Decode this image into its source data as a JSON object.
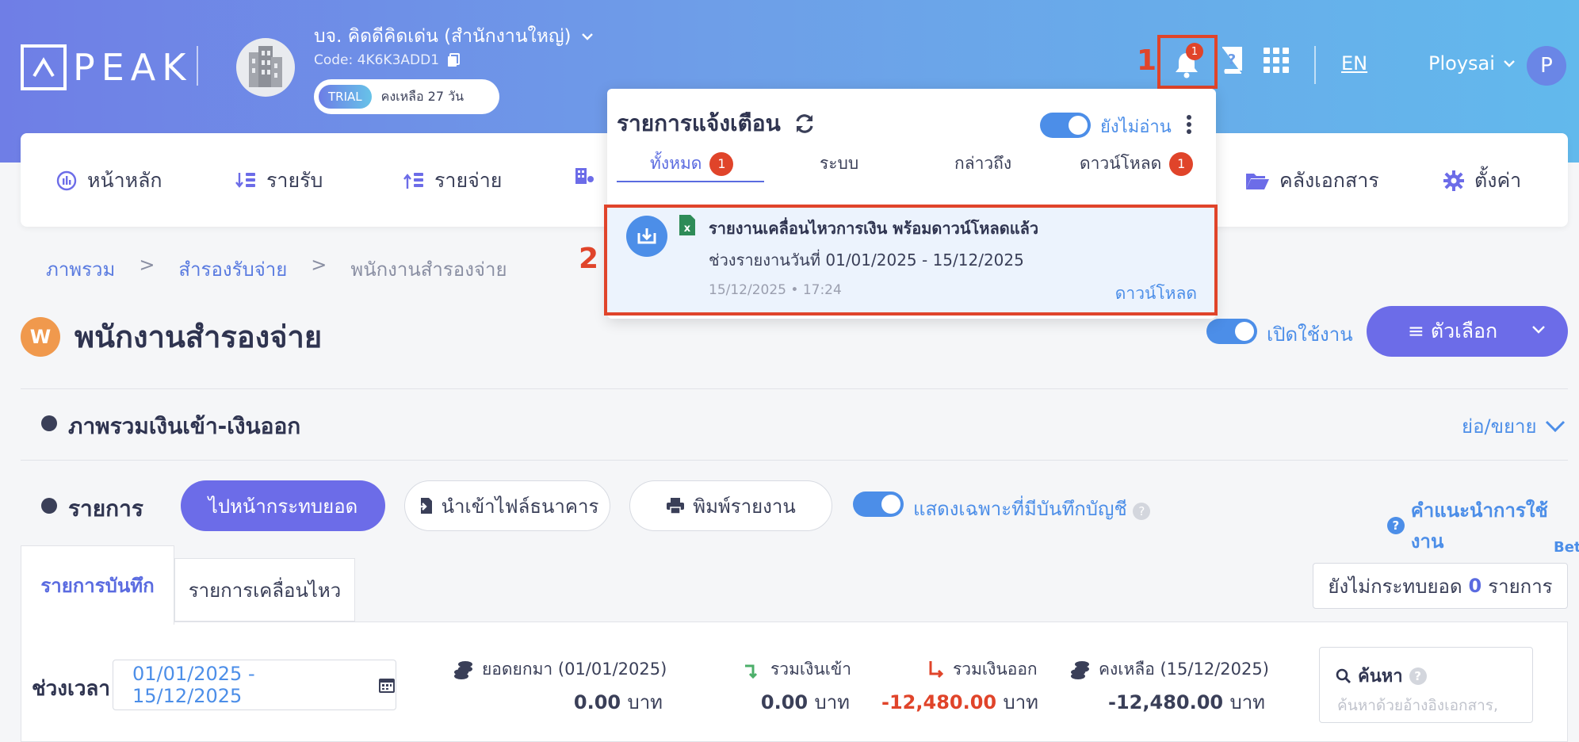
{
  "brand": {
    "logo_text": "PEAK"
  },
  "company": {
    "name": "บจ. คิดดีคิดเด่น (สำนักงานใหญ่)",
    "code": "Code: 4K6K3ADD1",
    "trial_label": "TRIAL",
    "trial_remaining": "คงเหลือ 27 วัน"
  },
  "header": {
    "bell_badge": "1",
    "language": "EN",
    "user_name": "Ploysai",
    "user_initial": "P"
  },
  "markers": {
    "one": "1",
    "two": "2"
  },
  "nav": {
    "items": [
      {
        "label": "หน้าหลัก"
      },
      {
        "label": "รายรับ"
      },
      {
        "label": "รายจ่าย"
      },
      {
        "label": "คลังเอกสาร"
      },
      {
        "label": "ตั้งค่า"
      }
    ]
  },
  "breadcrumb": {
    "items": [
      "ภาพรวม",
      ">",
      "สำรองรับจ่าย",
      ">",
      "พนักงานสำรองจ่าย"
    ]
  },
  "page": {
    "badge": "W",
    "title": "พนักงานสำรองจ่าย",
    "enabled_label": "เปิดใช้งาน",
    "options_label": "≡ ตัวเลือก"
  },
  "overview": {
    "title": "ภาพรวมเงินเข้า-เงินออก",
    "collapse_label": "ย่อ/ขยาย"
  },
  "list": {
    "title": "รายการ",
    "go_reconcile": "ไปหน้ากระทบยอด",
    "import_bank": "นำเข้าไฟล์ธนาคาร",
    "print_report": "พิมพ์รายงาน",
    "show_only_label": "แสดงเฉพาะที่มีบันทึกบัญชี",
    "help_label": "คำแนะนำการใช้งาน",
    "beta": "Bet"
  },
  "tabs": [
    {
      "label": "รายการบันทึก"
    },
    {
      "label": "รายการเคลื่อนไหว"
    }
  ],
  "unreconciled": {
    "prefix": "ยังไม่กระทบยอด",
    "count": "0",
    "suffix": "รายการ"
  },
  "summary": {
    "period_label": "ช่วงเวลา",
    "period_value": "01/01/2025 - 15/12/2025",
    "opening_label": "ยอดยกมา (01/01/2025)",
    "opening_value": "0.00",
    "in_label": "รวมเงินเข้า",
    "in_value": "0.00",
    "out_label": "รวมเงินออก",
    "out_value": "-12,480.00",
    "balance_label": "คงเหลือ (15/12/2025)",
    "balance_value": "-12,480.00",
    "unit": "บาท",
    "search_label": "ค้นหา",
    "search_placeholder": "ค้นหาด้วยอ้างอิงเอกสาร,"
  },
  "notifications": {
    "title": "รายการแจ้งเตือน",
    "unread_label": "ยังไม่อ่าน",
    "tabs": [
      {
        "label": "ทั้งหมด",
        "badge": "1"
      },
      {
        "label": "ระบบ"
      },
      {
        "label": "กล่าวถึง"
      },
      {
        "label": "ดาวน์โหลด",
        "badge": "1"
      }
    ],
    "item": {
      "title": "รายงานเคลื่อนไหวการเงิน พร้อมดาวน์โหลดแล้ว",
      "body": "ช่วงรายงานวันที่ 01/01/2025 - 15/12/2025",
      "time": "15/12/2025 • 17:24",
      "action": "ดาวน์โหลด"
    }
  },
  "colors": {
    "accent": "#6c6ce8",
    "link": "#4c8ee8",
    "alert": "#e0442a",
    "badge_w": "#f0994d"
  }
}
